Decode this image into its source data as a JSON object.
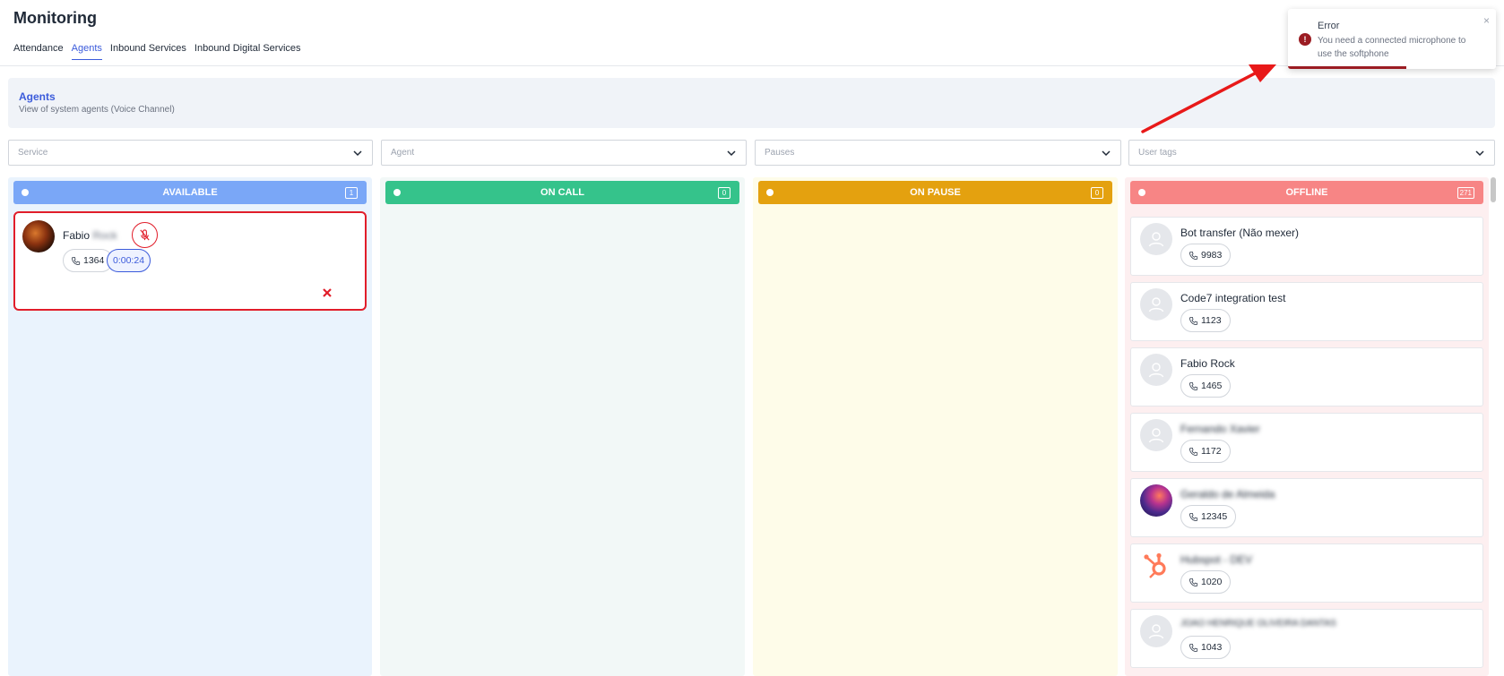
{
  "page": {
    "title": "Monitoring",
    "tabs": [
      {
        "label": "Attendance",
        "active": false
      },
      {
        "label": "Agents",
        "active": true
      },
      {
        "label": "Inbound Services",
        "active": false
      },
      {
        "label": "Inbound Digital Services",
        "active": false
      }
    ]
  },
  "banner": {
    "title": "Agents",
    "subtitle": "View of system agents (Voice Channel)"
  },
  "filters": {
    "service_placeholder": "Service",
    "agent_placeholder": "Agent",
    "pauses_placeholder": "Pauses",
    "user_tags_placeholder": "User tags"
  },
  "columns": {
    "available": {
      "label": "AVAILABLE",
      "count": "1",
      "header_color": "#7aa7f7",
      "bg_color": "#eaf3fd"
    },
    "on_call": {
      "label": "ON CALL",
      "count": "0",
      "header_color": "#35c38b",
      "bg_color": "#f2f8f7"
    },
    "on_pause": {
      "label": "ON PAUSE",
      "count": "0",
      "header_color": "#e4a10f",
      "bg_color": "#fefce9"
    },
    "offline": {
      "label": "OFFLINE",
      "count": "271",
      "header_color": "#f78585",
      "bg_color": "#fdeff0"
    }
  },
  "available_agents": [
    {
      "name": "Fabio",
      "surname_blurred": "Rock",
      "extension": "1364",
      "timer": "0:00:24",
      "mic_icon": "mic-off-icon",
      "remove_icon": "close-icon"
    }
  ],
  "offline_agents": [
    {
      "name": "Bot transfer (Não mexer)",
      "extension": "9983"
    },
    {
      "name": "Code7 integration test",
      "extension": "1123"
    },
    {
      "name": "Fabio Rock",
      "extension": "1465"
    },
    {
      "name": "Fernando Xavier",
      "extension": "1172"
    },
    {
      "name": "Geraldo de Almeida",
      "extension": "12345"
    },
    {
      "name": "Hubspot - DEV",
      "extension": "1020"
    },
    {
      "name": "JOAO HENRIQUE OLIVEIRA DANTAS",
      "extension": "1043"
    }
  ],
  "toast": {
    "title": "Error",
    "message": "You need a connected microphone to use the softphone",
    "close_glyph": "×",
    "icon_glyph": "!",
    "color": "#9b1c22"
  },
  "annotation": {
    "arrow_color": "#e81919",
    "highlight_color": "#e11d2a"
  }
}
